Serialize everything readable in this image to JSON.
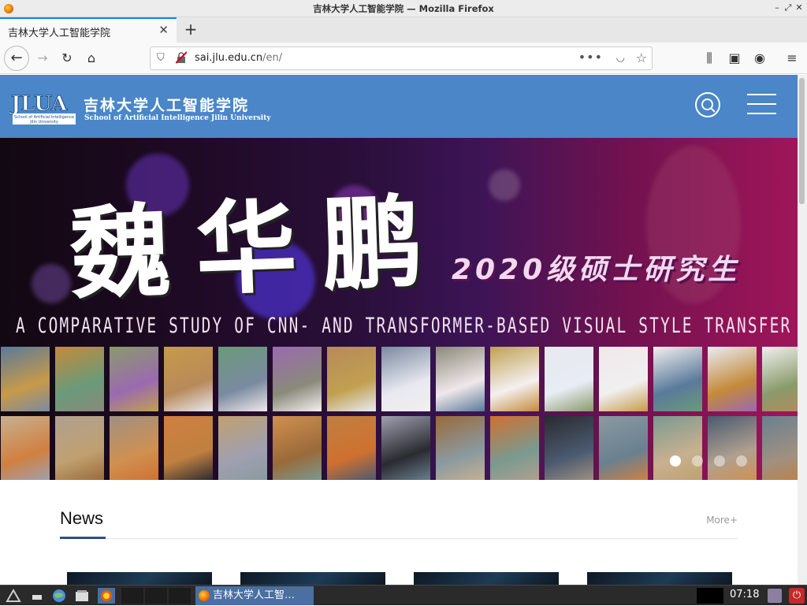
{
  "window": {
    "title": "吉林大学人工智能学院 — Mozilla Firefox"
  },
  "tabs": [
    {
      "label": "吉林大学人工智能学院"
    }
  ],
  "navbar": {
    "url_host": "sai.jlu.edu.cn",
    "url_path": "/en/",
    "more_label": "•••"
  },
  "site": {
    "logo_text": "JLUA",
    "logo_sub": "School of Artificial Intelligence Jilin University",
    "name_cn": "吉林大学人工智能学院",
    "name_en": "School of Artificial Intelligence Jilin University"
  },
  "banner": {
    "name": "魏华鹏",
    "subtitle": "2020级硕士研究生",
    "title": "A COMPARATIVE STUDY OF CNN- AND TRANSFORMER-BASED VISUAL STYLE TRANSFER",
    "slide_count": 4,
    "active_slide": 0
  },
  "news": {
    "heading": "News",
    "more_label": "More+"
  },
  "taskbar": {
    "task_label": "吉林大学人工智…",
    "clock": "07:18"
  }
}
